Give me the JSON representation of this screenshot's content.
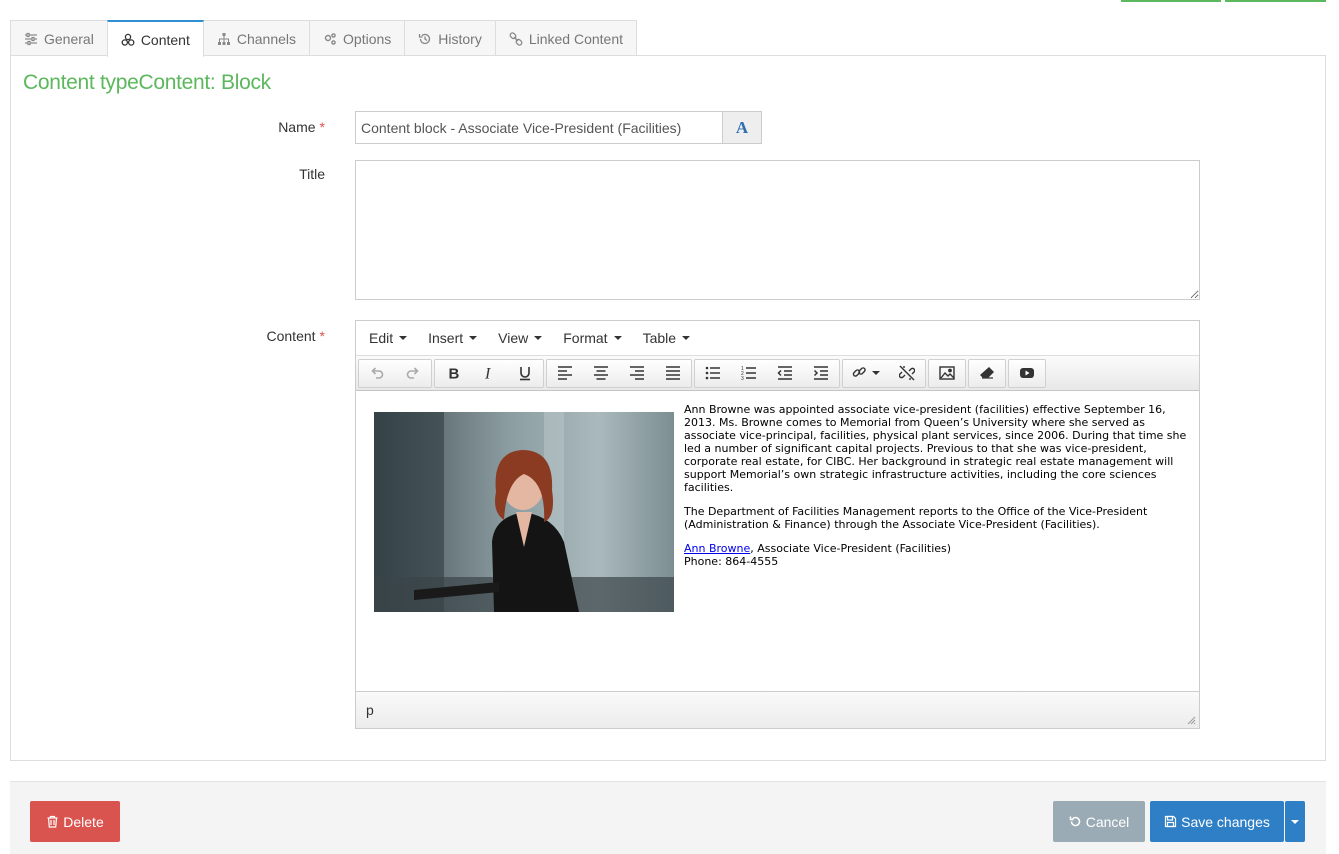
{
  "colors": {
    "accent_green": "#5cb85c",
    "primary": "#2f7fc7",
    "danger": "#d9534f",
    "muted": "#9aabb5"
  },
  "tabs": [
    {
      "label": "General",
      "icon": "sliders-icon"
    },
    {
      "label": "Content",
      "icon": "cubes-icon"
    },
    {
      "label": "Channels",
      "icon": "sitemap-icon"
    },
    {
      "label": "Options",
      "icon": "cogs-icon"
    },
    {
      "label": "History",
      "icon": "history-icon"
    },
    {
      "label": "Linked Content",
      "icon": "link-icon"
    }
  ],
  "active_tab": "Content",
  "heading": "Content typeContent: Block",
  "form": {
    "name_label": "Name",
    "name_value": "Content block - Associate Vice-President (Facilities)",
    "name_addon": "A",
    "title_label": "Title",
    "title_value": "",
    "content_label": "Content",
    "required_marker": "*"
  },
  "editor": {
    "menus": [
      "Edit",
      "Insert",
      "View",
      "Format",
      "Table"
    ],
    "status_path": "p",
    "paragraphs": [
      "Ann Browne was appointed associate vice-president (facilities) effective September 16, 2013.  Ms. Browne comes to Memorial from Queen’s University where she served as associate vice-principal, facilities, physical plant services, since 2006. During that time she led a number of significant capital projects. Previous to that she was vice-president, corporate real estate, for CIBC. Her background in strategic real estate management will support Memorial’s own strategic infrastructure activities, including the core sciences facilities.",
      "The Department of Facilities Management reports to the Office of the Vice-President (Administration & Finance) through the Associate Vice-President (Facilities)."
    ],
    "contact_link": "Ann Browne",
    "contact_title": ", Associate Vice-President (Facilities)",
    "contact_phone": "Phone:  864-4555"
  },
  "footer": {
    "delete_label": "Delete",
    "cancel_label": "Cancel",
    "save_label": "Save changes"
  }
}
